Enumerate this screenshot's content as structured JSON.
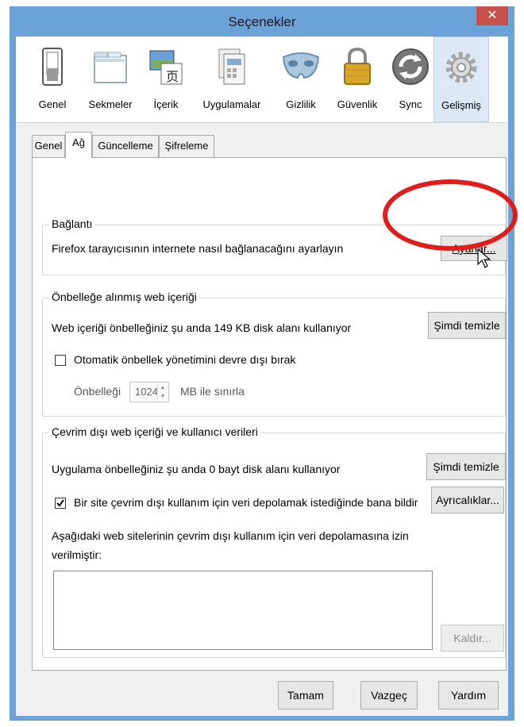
{
  "window": {
    "title": "Seçenekler",
    "close_glyph": "✕"
  },
  "toolbar": {
    "panes": [
      {
        "label": "Genel",
        "icon": "switch-icon"
      },
      {
        "label": "Sekmeler",
        "icon": "tabs-icon"
      },
      {
        "label": "İçerik",
        "icon": "content-icon"
      },
      {
        "label": "Uygulamalar",
        "icon": "applications-icon"
      },
      {
        "label": "Gizlilik",
        "icon": "mask-icon"
      },
      {
        "label": "Güvenlik",
        "icon": "padlock-icon"
      },
      {
        "label": "Sync",
        "icon": "sync-icon"
      },
      {
        "label": "Gelişmiş",
        "icon": "gear-icon",
        "selected": true
      }
    ]
  },
  "tabs": [
    {
      "label": "Genel"
    },
    {
      "label": "Ağ",
      "selected": true
    },
    {
      "label": "Güncelleme"
    },
    {
      "label": "Şifreleme"
    }
  ],
  "connection": {
    "title": "Bağlantı",
    "description": "Firefox tarayıcısının internete nasıl bağlanacağını ayarlayın",
    "settings_button": "Ayarlar..."
  },
  "cache": {
    "title": "Önbelleğe alınmış web içeriği",
    "usage_text": "Web içeriği önbelleğiniz şu anda 149 KB disk alanı kullanıyor",
    "clear_button": "Şimdi temizle",
    "override_checkbox_label": "Otomatik önbellek yönetimini devre dışı bırak",
    "override_checked": false,
    "limit_label": "Önbelleği",
    "limit_value": "1024",
    "limit_unit": "MB ile sınırla"
  },
  "offline": {
    "title": "Çevrim dışı web içeriği ve kullanıcı verileri",
    "usage_text": "Uygulama önbelleğiniz şu anda 0 bayt disk alanı kullanıyor",
    "clear_button": "Şimdi temizle",
    "notify_checkbox_label": "Bir site çevrim dışı kullanım için veri depolamak istediğinde bana bildir",
    "notify_checked": true,
    "exceptions_button": "Ayrıcalıklar...",
    "allowed_text_line1": "Aşağıdaki web sitelerinin çevrim dışı kullanım için veri depolamasına izin",
    "allowed_text_line2": "verilmiştir:",
    "remove_button": "Kaldır..."
  },
  "footer": {
    "ok_button": "Tamam",
    "cancel_button": "Vazgeç",
    "help_button": "Yardım"
  },
  "colors": {
    "titlebar": "#6ba2d8",
    "close": "#c7504a",
    "highlight": "#e21c1c",
    "selected_pane": "#dce8f5"
  }
}
